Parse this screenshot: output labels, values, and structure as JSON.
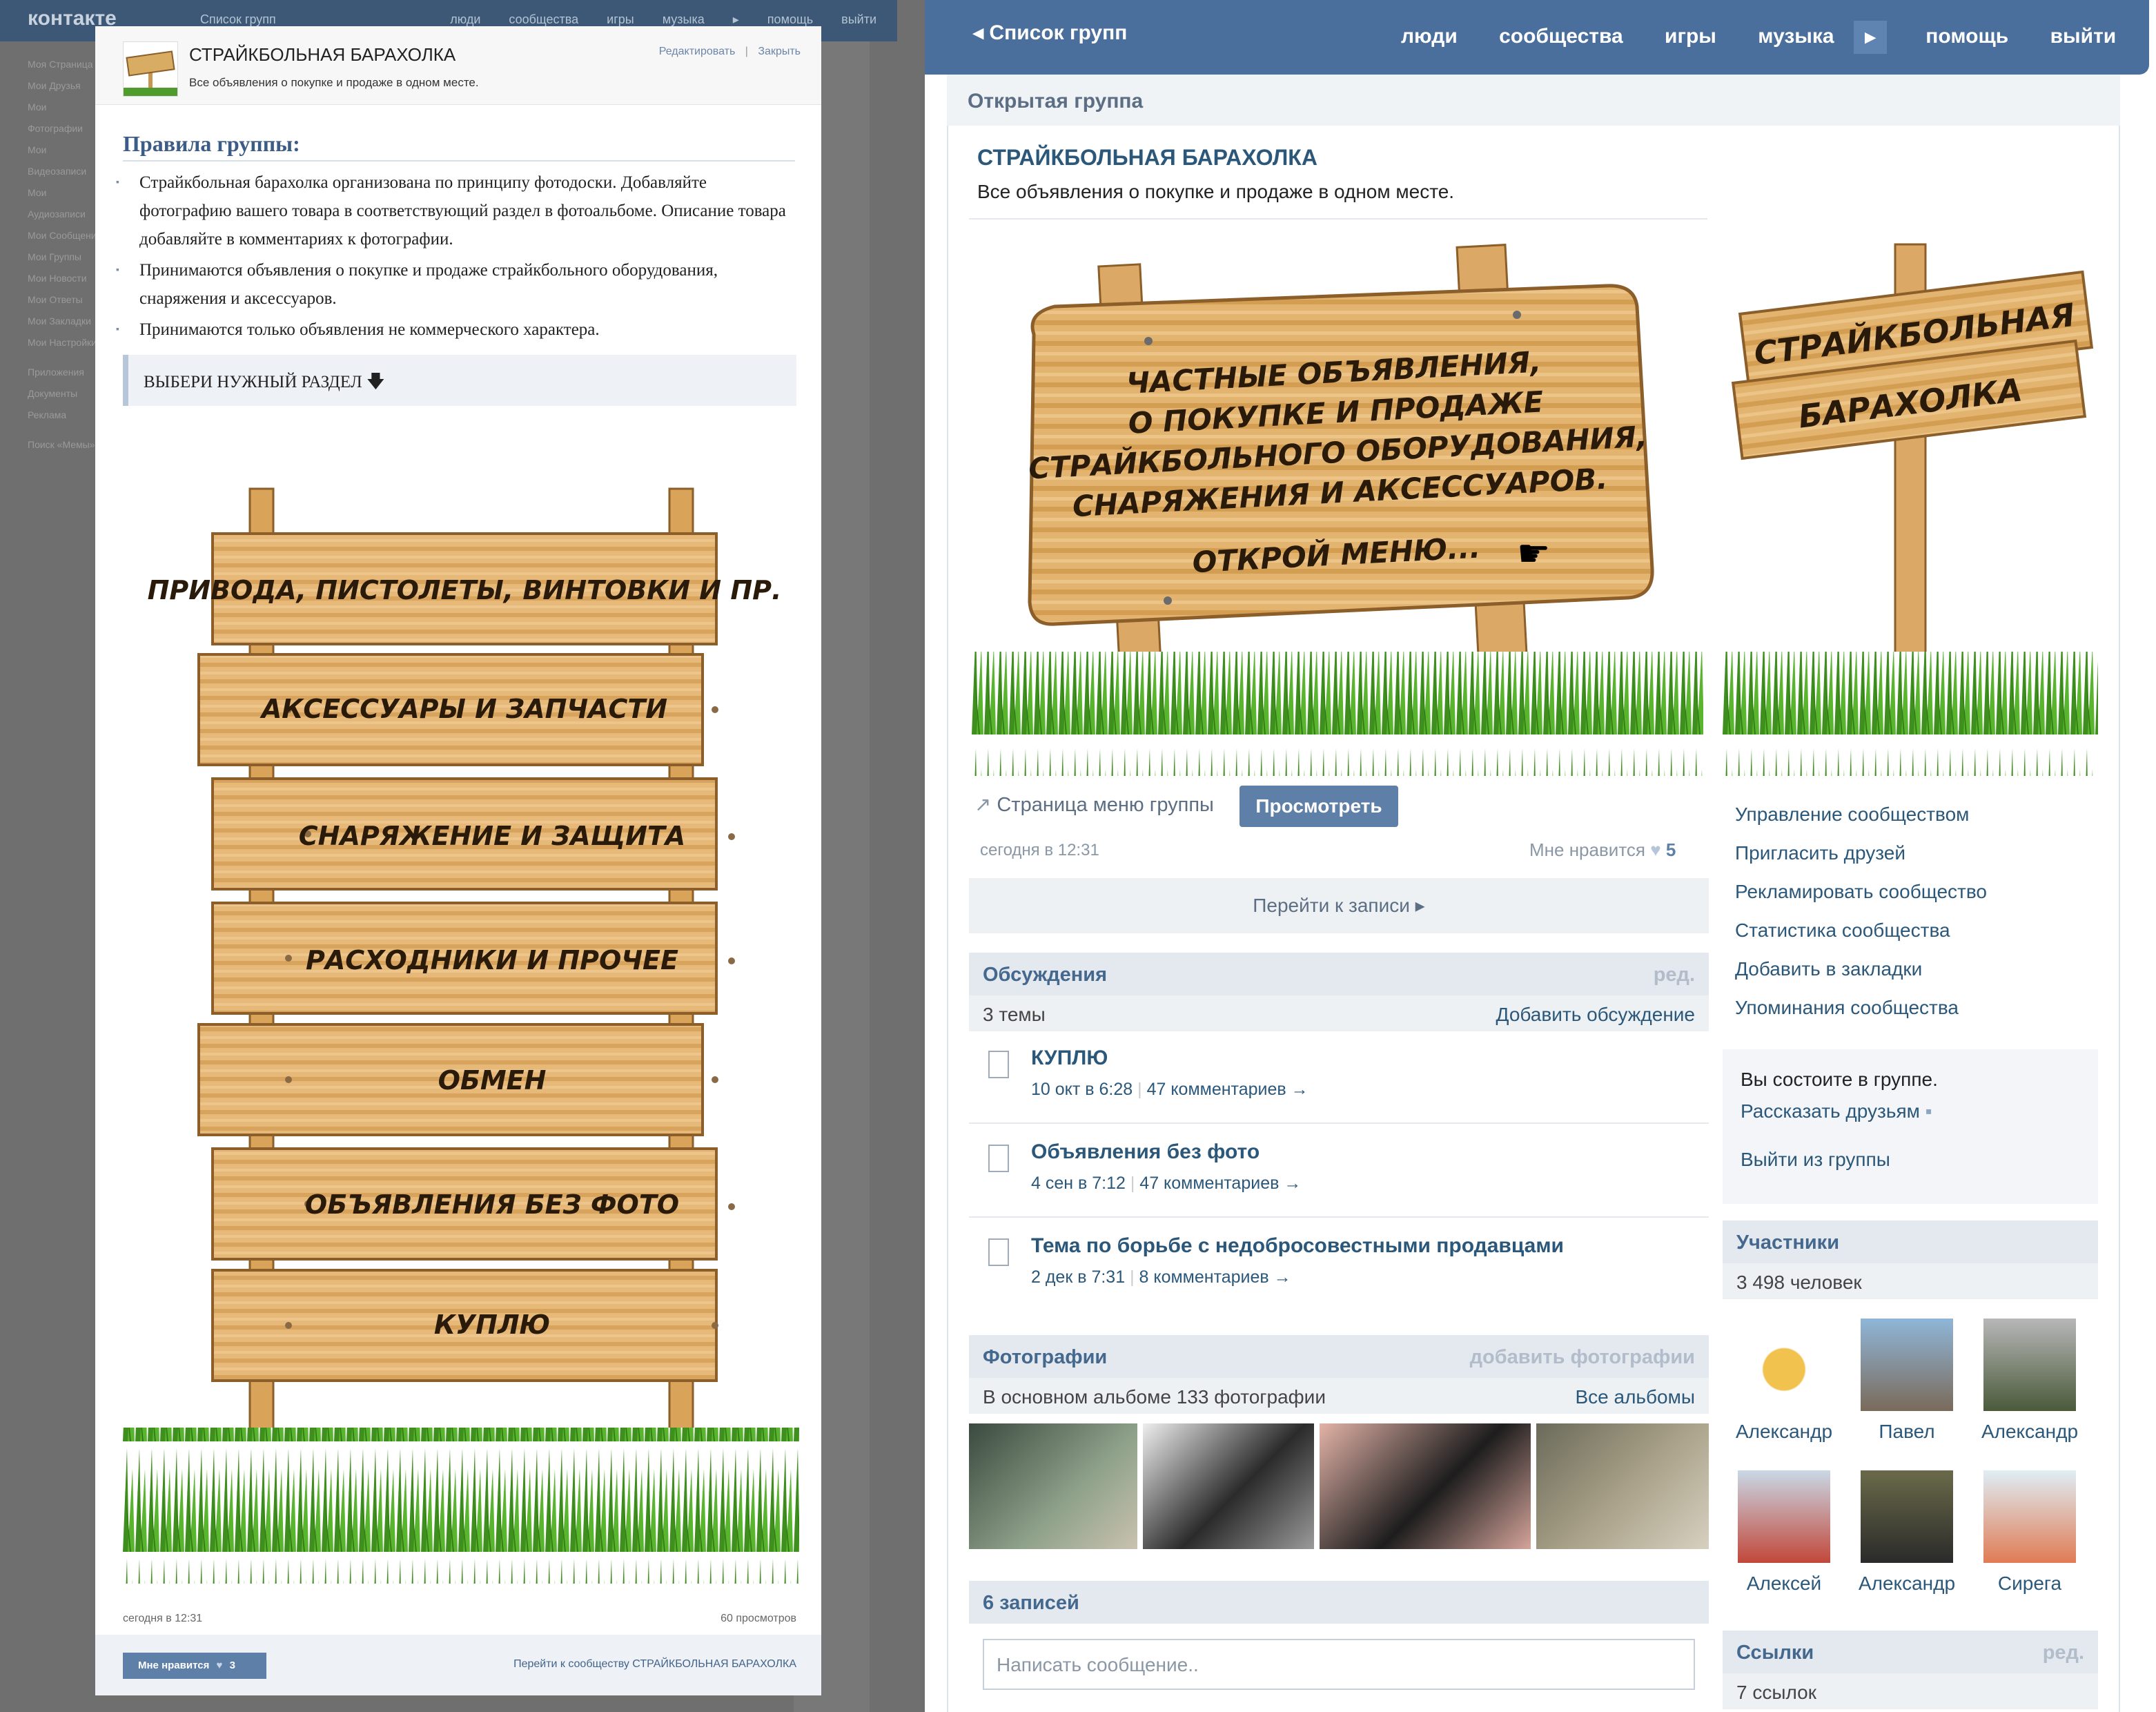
{
  "bg_header": {
    "logo": "контакте",
    "crumb": "Список групп",
    "nav": "люди сообщества игры музыка ▸ помощь выйти"
  },
  "bg_menu": [
    "Моя Страница",
    "Мои Друзья",
    "Мои Фотографии",
    "Мои Видеозаписи",
    "Мои Аудиозаписи",
    "Мои Сообщения",
    "Мои Группы",
    "Мои Новости",
    "Мои Ответы",
    "Мои Закладки",
    "Мои Настройки",
    "Приложения",
    "Документы",
    "Реклама",
    "Поиск «Мемы»"
  ],
  "modal": {
    "title": "СТРАЙКБОЛЬНАЯ БАРАХОЛКА",
    "subtitle": "Все объявления о покупке и продаже в одном месте.",
    "edit_link": "Редактировать",
    "sep": "|",
    "close_link": "Закрыть",
    "rules_heading": "Правила группы:",
    "rules": [
      "Страйкбольная барахолка организована по принципу фотодоски. Добавляйте фотографию вашего товара в соответствующий раздел в фотоальбоме. Описание товара добавляйте в комментариях к фотографии.",
      "Принимаются объявления о покупке и продаже страйкбольного оборудования, снаряжения и аксессуаров.",
      "Принимаются только объявления не коммерческого характера."
    ],
    "choose_section": "ВЫБЕРИ НУЖНЫЙ РАЗДЕЛ",
    "menu_signs": [
      "ПРИВОДА, ПИСТОЛЕТЫ, ВИНТОВКИ И ПР.",
      "АКСЕССУАРЫ И ЗАПЧАСТИ",
      "СНАРЯЖЕНИЕ И ЗАЩИТА",
      "РАСХОДНИКИ И ПРОЧЕЕ",
      "ОБМЕН",
      "ОБЪЯВЛЕНИЯ БЕЗ ФОТО",
      "КУПЛЮ"
    ],
    "posted": "сегодня в 12:31",
    "views": "60 просмотров",
    "like_label": "Мне нравится",
    "like_count": "3",
    "goto_community": "Перейти к сообществу СТРАЙКБОЛЬНАЯ БАРАХОЛКА"
  },
  "topbar": {
    "back": "Список групп",
    "nav": [
      "люди",
      "сообщества",
      "игры",
      "музыка"
    ],
    "nav_after": [
      "помощь",
      "выйти"
    ]
  },
  "group": {
    "type": "Открытая группа",
    "title": "СТРАЙКБОЛЬНАЯ БАРАХОЛКА",
    "description": "Все объявления о покупке и продаже в одном месте.",
    "banner_text": [
      "ЧАСТНЫЕ ОБЪЯВЛЕНИЯ,",
      "О ПОКУПКЕ И ПРОДАЖЕ",
      "СТРАЙКБОЛЬНОГО ОБОРУДОВАНИЯ,",
      "СНАРЯЖЕНИЯ И АКСЕССУАРОВ."
    ],
    "banner_cta": "ОТКРОЙ МЕНЮ...",
    "side_sign": [
      "СТРАЙКБОЛЬНАЯ",
      "БАРАХОЛКА"
    ],
    "menu_page": "Страница меню группы",
    "view_button": "Просмотреть",
    "posted": "сегодня в 12:31",
    "like_label": "Мне нравится",
    "like_count": "5",
    "goto_posts": "Перейти к записи"
  },
  "discussions": {
    "title": "Обсуждения",
    "edit": "ред.",
    "count": "3 темы",
    "add": "Добавить обсуждение",
    "topics": [
      {
        "title": "КУПЛЮ",
        "date": "10 окт в 6:28",
        "comments": "47 комментариев →"
      },
      {
        "title": "Объявления без фото",
        "date": "4 сен в 7:12",
        "comments": "47 комментариев →"
      },
      {
        "title": "Тема по борьбе с недобросовестными продавцами",
        "date": "2 дек в 7:31",
        "comments": "8 комментариев →"
      }
    ]
  },
  "photos": {
    "title": "Фотографии",
    "add": "добавить фотографии",
    "album": "В основном альбоме 133 фотографии",
    "all": "Все альбомы"
  },
  "wall": {
    "title": "6 записей",
    "placeholder": "Написать сообщение.."
  },
  "sidebar": {
    "links": [
      "Управление сообществом",
      "Пригласить друзей",
      "Рекламировать сообщество",
      "Статистика сообщества",
      "Добавить в закладки",
      "Упоминания сообщества"
    ],
    "member_status": "Вы состоите в группе.",
    "tell_friends": "Рассказать друзьям",
    "leave": "Выйти из группы",
    "participants_title": "Участники",
    "participants_count": "3 498 человек",
    "participants": [
      "Александр",
      "Павел",
      "Александр",
      "Алексей",
      "Александр",
      "Сирега"
    ],
    "links_title": "Ссылки",
    "links_edit": "ред.",
    "links_count": "7 ссылок"
  }
}
